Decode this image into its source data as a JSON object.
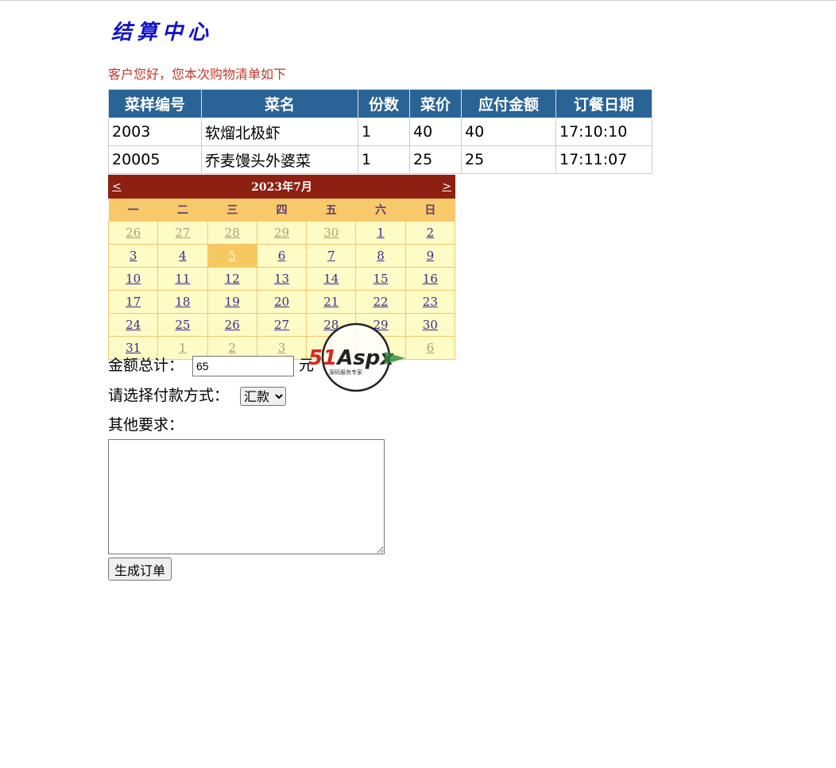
{
  "header": {
    "title": "结算中心"
  },
  "greeting": "客户您好，您本次购物清单如下",
  "order_table": {
    "columns": [
      "菜样编号",
      "菜名",
      "份数",
      "菜价",
      "应付金额",
      "订餐日期"
    ],
    "rows": [
      [
        "2003",
        "软熘北极虾",
        "1",
        "40",
        "40",
        "17:10:10"
      ],
      [
        "20005",
        "乔麦馒头外婆菜",
        "1",
        "25",
        "25",
        "17:11:07"
      ]
    ]
  },
  "calendar": {
    "prev": "<",
    "next": ">",
    "month_label": "2023年7月",
    "weekdays": [
      "一",
      "二",
      "三",
      "四",
      "五",
      "六",
      "日"
    ],
    "weeks": [
      [
        "26",
        "27",
        "28",
        "29",
        "30",
        "1",
        "2"
      ],
      [
        "3",
        "4",
        "5",
        "6",
        "7",
        "8",
        "9"
      ],
      [
        "10",
        "11",
        "12",
        "13",
        "14",
        "15",
        "16"
      ],
      [
        "17",
        "18",
        "19",
        "20",
        "21",
        "22",
        "23"
      ],
      [
        "24",
        "25",
        "26",
        "27",
        "28",
        "29",
        "30"
      ],
      [
        "31",
        "1",
        "2",
        "3",
        "4",
        "5",
        "6"
      ]
    ],
    "selected_day": "5"
  },
  "total": {
    "label": "金额总计：",
    "value": "65",
    "unit": "元"
  },
  "payment": {
    "label": "请选择付款方式：",
    "selected": "汇款"
  },
  "notes": {
    "label": "其他要求：",
    "value": ""
  },
  "submit_label": "生成订单",
  "watermark": {
    "brand": "51Aspx",
    "tagline": "源码服务专家"
  },
  "colors": {
    "title": "#1212c8",
    "greeting": "#c0392b",
    "table_header": "#2a6496",
    "calendar_header": "#8e2011",
    "calendar_weekday": "#f8c96a",
    "calendar_cell": "#fdfbc6",
    "calendar_selected": "#f6c860"
  }
}
